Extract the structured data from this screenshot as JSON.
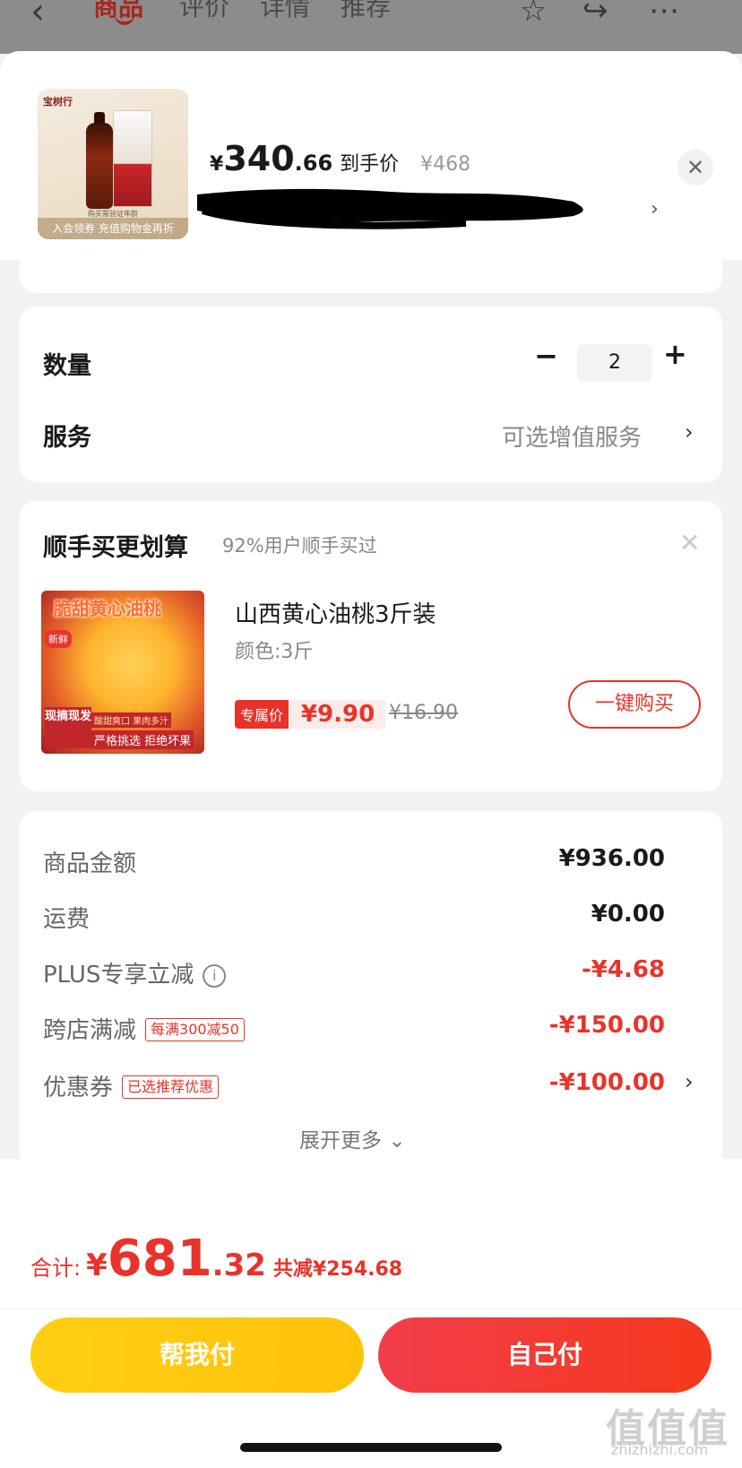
{
  "topnav": {
    "back_icon": "chevron-left",
    "tabs": [
      "商品",
      "评价",
      "详情",
      "推荐"
    ],
    "active_tab": 0,
    "right_icons": [
      "star-icon",
      "share-icon",
      "more-icon"
    ]
  },
  "product": {
    "thumb_brand": "宝树行",
    "thumb_small": "购买需验证年龄",
    "thumb_strip": "入会领券 充值购物金再折",
    "currency": "¥",
    "price_int": "340",
    "price_dec": ".66",
    "price_label": "到手价",
    "orig_price": "¥468"
  },
  "quantity": {
    "label": "数量",
    "value": "2",
    "minus": "−",
    "plus": "+"
  },
  "service": {
    "label": "服务",
    "value": "可选增值服务"
  },
  "addon": {
    "title": "顺手买更划算",
    "subtitle": "92%用户顺手买过",
    "image_text": [
      "脆甜黄心油桃",
      "新鲜",
      "现摘现发",
      "酸甜爽口 果肉多汁",
      "严格挑选 拒绝坏果"
    ],
    "name": "山西黄心油桃3斤装",
    "color": "颜色:3斤",
    "tag": "专属价",
    "price": "¥9.90",
    "old_price": "¥16.90",
    "button": "一键购买"
  },
  "amounts": {
    "rows": [
      {
        "label": "商品金额",
        "value": "¥936.00"
      },
      {
        "label": "运费",
        "value": "¥0.00"
      },
      {
        "label": "PLUS专享立减",
        "value": "-¥4.68"
      },
      {
        "label": "跨店满减",
        "tag": "每满300减50",
        "value": "-¥150.00"
      },
      {
        "label": "优惠券",
        "tag": "已选推荐优惠",
        "value": "-¥100.00"
      }
    ],
    "more": "展开更多"
  },
  "total": {
    "label": "合计:",
    "currency": "¥",
    "int": "681",
    "dec": ".32",
    "saved": "共减¥254.68"
  },
  "buttons": {
    "help": "帮我付",
    "self": "自己付"
  },
  "watermark": {
    "logo": "值值值",
    "url": "zhizhizhi.com"
  },
  "colors": {
    "accent_red": "#e9332a",
    "yellow": "#ffc20a"
  }
}
